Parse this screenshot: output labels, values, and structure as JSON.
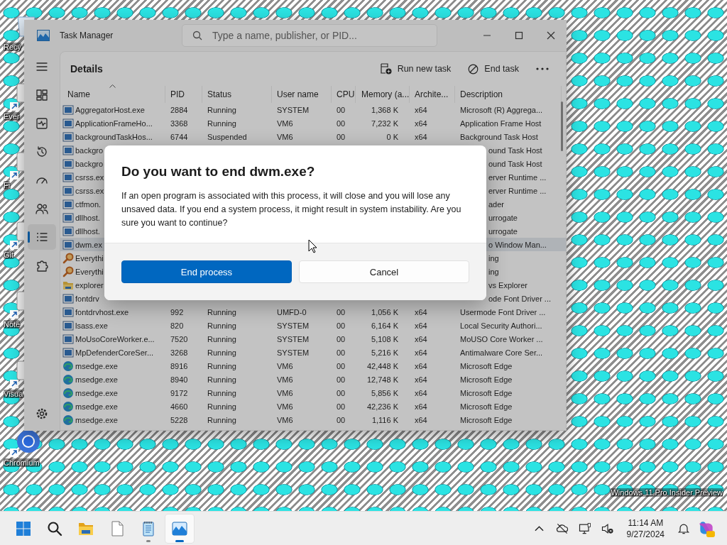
{
  "desktop": {
    "icons": [
      {
        "label": "Recy",
        "kind": "recycle"
      },
      {
        "label": "Ever",
        "kind": "shortcut"
      },
      {
        "label": "Fi",
        "kind": "shortcut"
      },
      {
        "label": "Git",
        "kind": "shortcut"
      },
      {
        "label": "Note",
        "kind": "shortcut"
      },
      {
        "label": "Visua",
        "kind": "shortcut"
      },
      {
        "label": "Chromium",
        "kind": "chromium"
      }
    ],
    "watermark": "Windows 11 Pro Insider Preview"
  },
  "task_manager": {
    "title": "Task Manager",
    "search": {
      "placeholder": "Type a name, publisher, or PID..."
    },
    "nav": [
      {
        "kind": "menu",
        "selected": false
      },
      {
        "kind": "processes",
        "selected": false
      },
      {
        "kind": "performance",
        "selected": false
      },
      {
        "kind": "history",
        "selected": false
      },
      {
        "kind": "startup",
        "selected": false
      },
      {
        "kind": "users",
        "selected": false
      },
      {
        "kind": "details",
        "selected": true
      },
      {
        "kind": "services",
        "selected": false
      },
      {
        "kind": "settings",
        "selected": false
      }
    ],
    "page_title": "Details",
    "actions": [
      {
        "label": "Run new task",
        "kind": "run"
      },
      {
        "label": "End task",
        "kind": "end"
      },
      {
        "kind": "more"
      }
    ],
    "columns": [
      {
        "label": "Name",
        "sorted": true
      },
      {
        "label": "PID",
        "sorted": false
      },
      {
        "label": "Status",
        "sorted": false
      },
      {
        "label": "User name",
        "sorted": false
      },
      {
        "label": "CPU",
        "sorted": false
      },
      {
        "label": "Memory (a...",
        "sorted": false
      },
      {
        "label": "Archite...",
        "sorted": false
      },
      {
        "label": "Description",
        "sorted": false
      }
    ],
    "rows": [
      {
        "kind": "app",
        "name": "AggregatorHost.exe",
        "pid": "2884",
        "status": "Running",
        "user": "SYSTEM",
        "cpu": "00",
        "memory": "1,368 K",
        "arch": "x64",
        "description": "Microsoft (R) Aggrega...",
        "selected": false
      },
      {
        "kind": "app",
        "name": "ApplicationFrameHo...",
        "pid": "3368",
        "status": "Running",
        "user": "VM6",
        "cpu": "00",
        "memory": "7,232 K",
        "arch": "x64",
        "description": "Application Frame Host",
        "selected": false
      },
      {
        "kind": "app",
        "name": "backgroundTaskHos...",
        "pid": "6744",
        "status": "Suspended",
        "user": "VM6",
        "cpu": "00",
        "memory": "0 K",
        "arch": "x64",
        "description": "Background Task Host",
        "selected": false
      },
      {
        "kind": "app",
        "name": "backgro",
        "description": "ound Task Host",
        "selected": false
      },
      {
        "kind": "app",
        "name": "backgro",
        "description": "ound Task Host",
        "selected": false
      },
      {
        "kind": "app",
        "name": "csrss.ex",
        "description": "erver Runtime ...",
        "selected": false
      },
      {
        "kind": "app",
        "name": "csrss.ex",
        "description": "erver Runtime ...",
        "selected": false
      },
      {
        "kind": "app",
        "name": "ctfmon.",
        "description": "ader",
        "selected": false
      },
      {
        "kind": "app",
        "name": "dllhost.",
        "description": "urrogate",
        "selected": false
      },
      {
        "kind": "app",
        "name": "dllhost.",
        "description": "urrogate",
        "selected": false
      },
      {
        "kind": "app",
        "name": "dwm.ex",
        "description": "o Window Man...",
        "selected": true
      },
      {
        "kind": "search",
        "name": "Everythi",
        "description": "ing",
        "selected": false
      },
      {
        "kind": "search",
        "name": "Everythi",
        "description": "ing",
        "selected": false
      },
      {
        "kind": "folder",
        "name": "explorer",
        "description": "vs Explorer",
        "selected": false
      },
      {
        "kind": "app",
        "name": "fontdrv",
        "description": "ode Font Driver ...",
        "selected": false
      },
      {
        "kind": "app",
        "name": "fontdrvhost.exe",
        "pid": "992",
        "status": "Running",
        "user": "UMFD-0",
        "cpu": "00",
        "memory": "1,056 K",
        "arch": "x64",
        "description": "Usermode Font Driver ...",
        "selected": false
      },
      {
        "kind": "app",
        "name": "lsass.exe",
        "pid": "820",
        "status": "Running",
        "user": "SYSTEM",
        "cpu": "00",
        "memory": "6,164 K",
        "arch": "x64",
        "description": "Local Security Authori...",
        "selected": false
      },
      {
        "kind": "app",
        "name": "MoUsoCoreWorker.e...",
        "pid": "7520",
        "status": "Running",
        "user": "SYSTEM",
        "cpu": "00",
        "memory": "5,108 K",
        "arch": "x64",
        "description": "MoUSO Core Worker ...",
        "selected": false
      },
      {
        "kind": "app",
        "name": "MpDefenderCoreSer...",
        "pid": "3268",
        "status": "Running",
        "user": "SYSTEM",
        "cpu": "00",
        "memory": "5,216 K",
        "arch": "x64",
        "description": "Antimalware Core Ser...",
        "selected": false
      },
      {
        "kind": "edge",
        "name": "msedge.exe",
        "pid": "8916",
        "status": "Running",
        "user": "VM6",
        "cpu": "00",
        "memory": "42,448 K",
        "arch": "x64",
        "description": "Microsoft Edge",
        "selected": false
      },
      {
        "kind": "edge",
        "name": "msedge.exe",
        "pid": "8940",
        "status": "Running",
        "user": "VM6",
        "cpu": "00",
        "memory": "12,748 K",
        "arch": "x64",
        "description": "Microsoft Edge",
        "selected": false
      },
      {
        "kind": "edge",
        "name": "msedge.exe",
        "pid": "9172",
        "status": "Running",
        "user": "VM6",
        "cpu": "00",
        "memory": "5,856 K",
        "arch": "x64",
        "description": "Microsoft Edge",
        "selected": false
      },
      {
        "kind": "edge",
        "name": "msedge.exe",
        "pid": "4660",
        "status": "Running",
        "user": "VM6",
        "cpu": "00",
        "memory": "42,236 K",
        "arch": "x64",
        "description": "Microsoft Edge",
        "selected": false
      },
      {
        "kind": "edge",
        "name": "msedge.exe",
        "pid": "5228",
        "status": "Running",
        "user": "VM6",
        "cpu": "00",
        "memory": "1,116 K",
        "arch": "x64",
        "description": "Microsoft Edge",
        "selected": false
      }
    ],
    "dialog": {
      "title": "Do you want to end dwm.exe?",
      "message": "If an open program is associated with this process, it will close and you will lose any unsaved data. If you end a system process, it might result in system instability. Are you sure you want to continue?",
      "buttons": [
        {
          "label": "End process",
          "kind": "primary"
        },
        {
          "label": "Cancel",
          "kind": "secondary"
        }
      ]
    }
  },
  "taskbar": {
    "apps": [
      {
        "kind": "start",
        "running": false,
        "active": false
      },
      {
        "kind": "search",
        "running": false,
        "active": false
      },
      {
        "kind": "folder",
        "running": false,
        "active": false
      },
      {
        "kind": "file",
        "running": false,
        "active": false
      },
      {
        "kind": "notepad",
        "running": true,
        "active": false
      },
      {
        "kind": "taskmanager",
        "running": true,
        "active": true
      }
    ],
    "tray": [
      {
        "kind": "chevron"
      },
      {
        "kind": "cloud-off"
      },
      {
        "kind": "monitor"
      },
      {
        "kind": "speaker-muted"
      }
    ],
    "clock": {
      "time": "11:14 AM",
      "date": "9/27/2024"
    },
    "end": [
      {
        "kind": "bell"
      },
      {
        "kind": "copilot"
      }
    ]
  }
}
